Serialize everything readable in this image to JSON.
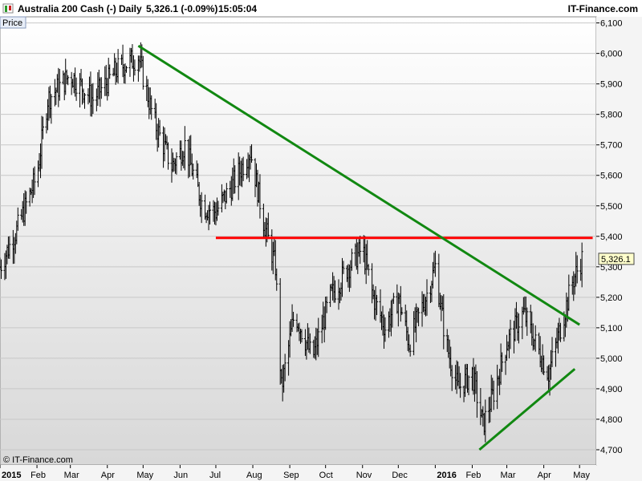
{
  "header": {
    "instrument": "Australia 200 Cash (-)",
    "timeframe": "Daily",
    "last_change": "5,326.1 (-0.09%)",
    "time": "15:05:04",
    "brand": "IT-Finance.com"
  },
  "copyright": "© IT-Finance.com",
  "price_tab": "Price",
  "current_price_label": "5,326.1",
  "colors": {
    "bars": "#000000",
    "support_resistance": "#ff0000",
    "trendline": "#118811",
    "grid": "#c8c8c8",
    "background_top": "#ffffff",
    "background_bottom": "#d8d8d8"
  },
  "chart_data": {
    "type": "ohlc",
    "title": "Australia 200 Cash (-)",
    "ylim": [
      4650,
      6120
    ],
    "y_ticks": [
      4700,
      4800,
      4900,
      5000,
      5100,
      5200,
      5300,
      5400,
      5500,
      5600,
      5700,
      5800,
      5900,
      6000,
      6100
    ],
    "y_tick_labels": [
      "4,700",
      "4,800",
      "4,900",
      "5,000",
      "5,100",
      "5,200",
      "5,300",
      "5,400",
      "5,500",
      "5,600",
      "5,700",
      "5,800",
      "5,900",
      "6,000",
      "6,100"
    ],
    "x_range": [
      "2015-01-01",
      "2016-05-15"
    ],
    "x_ticks": [
      {
        "label": "2015",
        "date": "2015-01-01",
        "bold": true
      },
      {
        "label": "Feb",
        "date": "2015-02-01"
      },
      {
        "label": "Mar",
        "date": "2015-03-01"
      },
      {
        "label": "Apr",
        "date": "2015-04-01"
      },
      {
        "label": "May",
        "date": "2015-05-01"
      },
      {
        "label": "Jun",
        "date": "2015-06-01"
      },
      {
        "label": "Jul",
        "date": "2015-07-01"
      },
      {
        "label": "Aug",
        "date": "2015-08-01"
      },
      {
        "label": "Sep",
        "date": "2015-09-01"
      },
      {
        "label": "Oct",
        "date": "2015-10-01"
      },
      {
        "label": "Nov",
        "date": "2015-11-01"
      },
      {
        "label": "Dec",
        "date": "2015-12-01"
      },
      {
        "label": "2016",
        "date": "2016-01-01",
        "bold": true
      },
      {
        "label": "Feb",
        "date": "2016-02-01"
      },
      {
        "label": "Mar",
        "date": "2016-03-01"
      },
      {
        "label": "Apr",
        "date": "2016-04-01"
      },
      {
        "label": "May",
        "date": "2016-05-01"
      }
    ],
    "grid": true,
    "close_path": [
      [
        "2015-01-01",
        5300
      ],
      [
        "2015-01-15",
        5420
      ],
      [
        "2015-02-01",
        5600
      ],
      [
        "2015-02-10",
        5850
      ],
      [
        "2015-03-01",
        5930
      ],
      [
        "2015-03-20",
        5850
      ],
      [
        "2015-04-10",
        5950
      ],
      [
        "2015-04-27",
        5990
      ],
      [
        "2015-05-10",
        5780
      ],
      [
        "2015-05-25",
        5630
      ],
      [
        "2015-06-05",
        5700
      ],
      [
        "2015-06-20",
        5500
      ],
      [
        "2015-07-01",
        5480
      ],
      [
        "2015-07-15",
        5570
      ],
      [
        "2015-07-30",
        5680
      ],
      [
        "2015-08-10",
        5450
      ],
      [
        "2015-08-20",
        5300
      ],
      [
        "2015-08-25",
        4900
      ],
      [
        "2015-09-05",
        5150
      ],
      [
        "2015-09-20",
        5000
      ],
      [
        "2015-10-05",
        5200
      ],
      [
        "2015-10-20",
        5300
      ],
      [
        "2015-11-01",
        5360
      ],
      [
        "2015-11-10",
        5200
      ],
      [
        "2015-11-20",
        5100
      ],
      [
        "2015-12-01",
        5200
      ],
      [
        "2015-12-10",
        5050
      ],
      [
        "2015-12-24",
        5200
      ],
      [
        "2016-01-01",
        5300
      ],
      [
        "2016-01-10",
        5050
      ],
      [
        "2016-01-20",
        4900
      ],
      [
        "2016-02-01",
        4950
      ],
      [
        "2016-02-10",
        4780
      ],
      [
        "2016-02-20",
        4900
      ],
      [
        "2016-03-01",
        5050
      ],
      [
        "2016-03-15",
        5150
      ],
      [
        "2016-03-25",
        5050
      ],
      [
        "2016-04-05",
        4950
      ],
      [
        "2016-04-15",
        5100
      ],
      [
        "2016-04-25",
        5250
      ],
      [
        "2016-05-03",
        5326
      ]
    ],
    "annotations": [
      {
        "kind": "horizontal_line",
        "color": "#ff0000",
        "y": 5395,
        "x_start": "2015-07-01",
        "x_end": "2016-05-12"
      },
      {
        "kind": "trendline",
        "color": "#118811",
        "from": [
          "2015-04-27",
          6025
        ],
        "to": [
          "2016-05-01",
          5110
        ]
      },
      {
        "kind": "trendline",
        "color": "#118811",
        "from": [
          "2016-02-07",
          4700
        ],
        "to": [
          "2016-04-27",
          4965
        ]
      }
    ],
    "last_price": 5326.1
  }
}
